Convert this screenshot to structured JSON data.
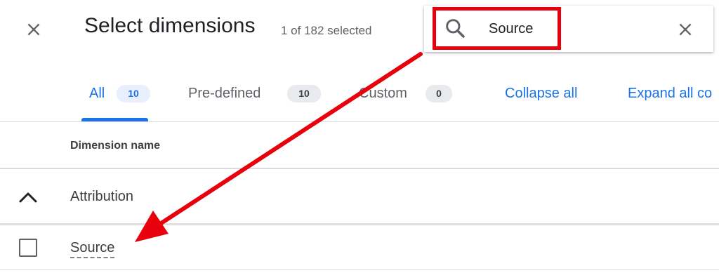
{
  "header": {
    "title": "Select dimensions",
    "selection_count": "1 of 182 selected",
    "close_icon": "close-icon"
  },
  "search": {
    "value": "Source",
    "icon": "search-icon",
    "clear_icon": "close-icon"
  },
  "tabs": [
    {
      "label": "All",
      "count": "10",
      "active": true
    },
    {
      "label": "Pre-defined",
      "count": "10",
      "active": false
    },
    {
      "label": "Custom",
      "count": "0",
      "active": false
    }
  ],
  "actions": {
    "collapse_all": "Collapse all",
    "expand_all": "Expand all co"
  },
  "table": {
    "column_header": "Dimension name",
    "groups": [
      {
        "label": "Attribution",
        "expanded": true,
        "rows": [
          {
            "label": "Source",
            "checked": false
          }
        ]
      }
    ]
  },
  "colors": {
    "accent": "#1a73e8",
    "annotation": "#e8000c",
    "text": "#202124",
    "muted": "#5f6368"
  }
}
